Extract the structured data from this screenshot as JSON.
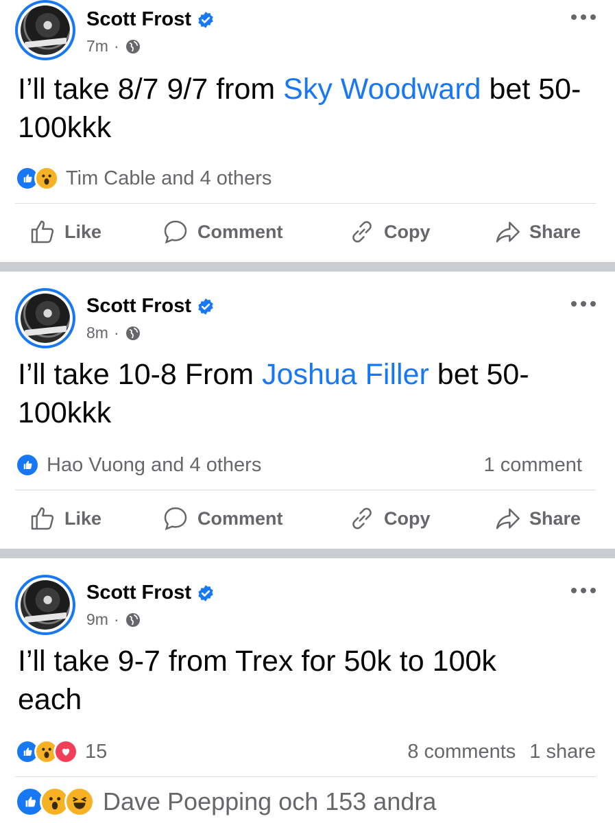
{
  "posts": [
    {
      "author": "Scott Frost",
      "time": "7m",
      "text_before": "I’ll take 8/7 9/7 from ",
      "mention": "Sky Woodward",
      "text_after": " bet 50-100kkk",
      "reactions_text": "Tim Cable and 4 others",
      "reaction_icons": [
        "like-icon",
        "wow-icon"
      ],
      "comments_text": "",
      "shares_text": ""
    },
    {
      "author": "Scott Frost",
      "time": "8m",
      "text_before": "I’ll take 10-8 From ",
      "mention": "Joshua Filler",
      "text_after": " bet 50-100kkk",
      "reactions_text": "Hao Vuong and 4 others",
      "reaction_icons": [
        "like-icon"
      ],
      "comments_text": "1 comment",
      "shares_text": ""
    },
    {
      "author": "Scott Frost",
      "time": "9m",
      "text_before": "I’ll take 9-7 from Trex for 50k to 100k each",
      "mention": "",
      "text_after": "",
      "reactions_text": "15",
      "reaction_icons": [
        "like-icon",
        "wow-icon",
        "love-icon"
      ],
      "comments_text": "8 comments",
      "shares_text": "1 share"
    }
  ],
  "actions": {
    "like": "Like",
    "comment": "Comment",
    "copy": "Copy",
    "share": "Share"
  },
  "footer": {
    "reactions_text": "Dave Poepping och 153 andra",
    "reaction_icons": [
      "like-icon",
      "wow-icon",
      "haha-icon"
    ]
  },
  "colors": {
    "accent": "#1877f2",
    "secondary_text": "#65676b",
    "separator": "#c9ccd1"
  }
}
